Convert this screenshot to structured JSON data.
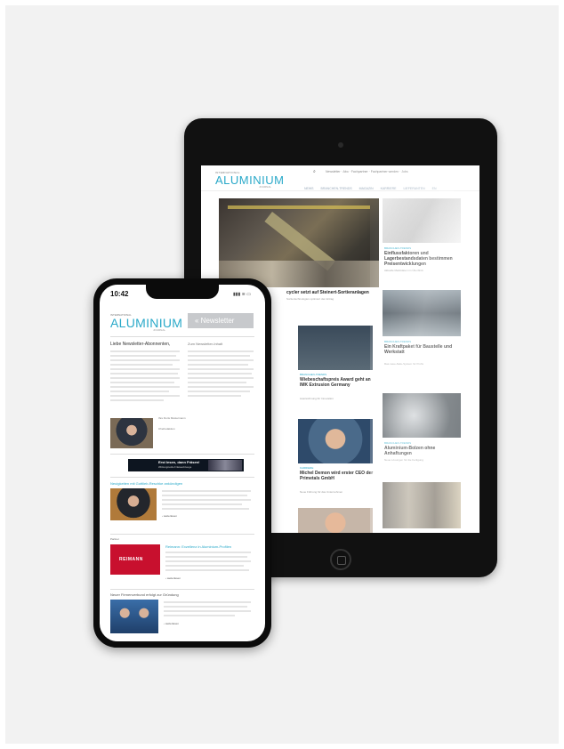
{
  "tablet": {
    "logo_small": "INTERNATIONAL",
    "logo": "ALUMINIUM",
    "logo_sub": "JOURNAL",
    "top_links": "Newsletter · Abo · Fachpartner · Fachpartner werden · Jobs",
    "nav": [
      "NEWS",
      "BRANCHEN-TRENDS",
      "MAGAZIN",
      "KARRIERE",
      "LIEFERANTEN",
      "EN"
    ],
    "hero_title": "cycler setzt auf Steinert-Sortieranlagen",
    "hero_sub": "Sortiertechnologien optimiert den Ertrag",
    "side": [
      {
        "tag": "BRANCHEN-TRENDS",
        "title": "Einflussfaktoren und Lagerbestandsdaten bestimmen Preisentwicklungen",
        "text": "Aktuelle Marktdaten im Überblick"
      },
      {
        "tag": "BRANCHEN-TRENDS",
        "title": "Ein Kraftpaket für Baustelle und Werkstatt",
        "text": "Das neue Akku-System für Profis"
      },
      {
        "tag": "BRANCHEN-TRENDS",
        "title": "Aluminium-Bolzen ohne Anhaftungen",
        "text": "Neue Lösungen für die Fertigung"
      }
    ],
    "cards": [
      {
        "tag": "BRANCHEN-TRENDS",
        "title": "Wiebeschaftspreis Award geht an IMK Extrusion Germany",
        "text": "Auszeichnung für Innovation"
      },
      {
        "tag": "KARRIERE",
        "title": "Michel Demon wird erster CEO der Primetals GmbH",
        "text": "Neue Führung für das Unternehmen"
      }
    ]
  },
  "phone": {
    "time": "10:42",
    "status_icons": "▮▮▮ ≋ ▭",
    "logo_small": "INTERNATIONAL",
    "logo": "ALUMINIUM",
    "logo_sub": "JOURNAL",
    "banner": "« Newsletter",
    "greeting": "Liebe Newsletter-Abonnenten,",
    "column_head": "Zum Newsletter-Inhalt",
    "signature": [
      "Ihre Doris Mustermann",
      "Chefredaktion"
    ],
    "ad_title": "Erst lesen, dann Fräsen!",
    "ad_sub": "Wirkungsvolle Fräswerkzeuge",
    "sections": [
      {
        "title": "Neuigkeiten mit Gottlieb-Reschke ankündigen",
        "more": "› weiterlesen"
      },
      {
        "title": "Reimann: Exzellenz in Aluminium-Profilen",
        "label": "Partner",
        "more": "› weiterlesen",
        "logo": "REIMANN"
      },
      {
        "title": "Neuer Firmenverbund erfolgt zur Gründung",
        "more": "› weiterlesen"
      }
    ]
  }
}
